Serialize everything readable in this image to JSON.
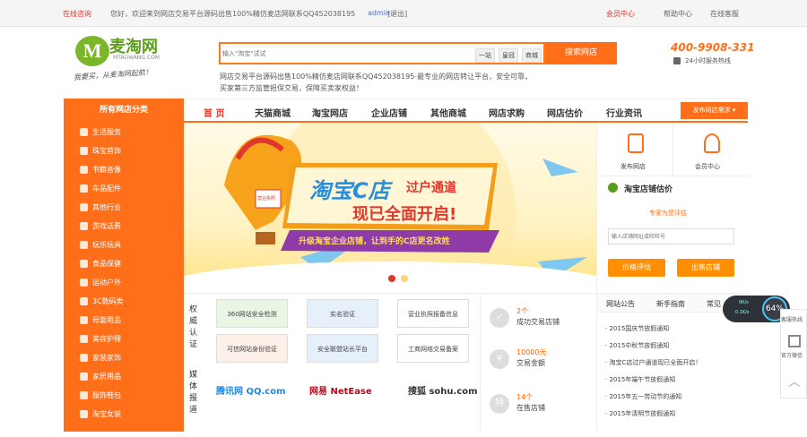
{
  "topbar": {
    "online": "在线咨询",
    "welcome": "您好，欢迎来到网店交易平台源码出售100%精仿麦店网联系QQ452038195",
    "user": "admin",
    "logout": "[退出]",
    "member": "会员中心",
    "help": "帮助中心",
    "online_service": "在线客服"
  },
  "logo": {
    "name": "麦淘网",
    "domain": "MTAOWANG.COM",
    "slogan": "我要买，从麦淘网起航！"
  },
  "search": {
    "placeholder": "输入\"淘宝\"试试",
    "filters": [
      "一站",
      "皇冠",
      "商城"
    ],
    "button": "搜索网店"
  },
  "hotline": {
    "number": "400-9908-331",
    "label": "24小时服务热线"
  },
  "description": "网店交易平台源码出售100%精仿麦店网联系QQ452038195-最专业的网店转让平台，安全可靠，买家第三方监管担保交易，保障买卖家权益！",
  "nav": {
    "category_title": "所有网店分类",
    "items": [
      "首 页",
      "天猫商城",
      "淘宝网店",
      "企业店铺",
      "其他商城",
      "网店求购",
      "网店估价",
      "行业资讯"
    ],
    "publish": "发布网店需求 ▾"
  },
  "categories": [
    "生活服务",
    "珠宝首饰",
    "书籍音像",
    "车品配件",
    "其他行业",
    "游戏话费",
    "玩乐玩具",
    "食品保健",
    "运动户外",
    "3C数码类",
    "母婴用品",
    "美容护理",
    "家装家饰",
    "家居用品",
    "服饰鞋包",
    "淘宝女装"
  ],
  "banner": {
    "title": "淘宝C店",
    "subtitle1": "过户通道",
    "subtitle2": "现已全面开启!",
    "tagline": "升级淘宝企业店铺，让到手的C店更名改姓",
    "badge": "营业执照"
  },
  "right": {
    "publish_shop": "发布网店",
    "member_center": "会员中心",
    "valuation_title": "淘宝店铺估价",
    "valuation_sub": "专家为您评估",
    "input_placeholder": "输入店铺网址或旺旺号",
    "valuation_btn": "价格评估",
    "sell_btn": "出售店铺",
    "tabs": [
      "网站公告",
      "新手指南",
      "常见"
    ],
    "news": [
      "2015国庆节放假通知",
      "2015中秋节放假通知",
      "淘宝C店过户通道现已全面开启！",
      "2015年端午节放假通知",
      "2015年五一劳动节的通知",
      "2015年清明节放假通知"
    ]
  },
  "auth": {
    "label1": "权威认证",
    "label2": "媒体报道",
    "certs": [
      "360网站安全检测",
      "实名验证",
      "营业执照报备信息",
      "可信网站身份验证",
      "安全联盟站长平台",
      "工商网络交易备案"
    ],
    "media": [
      "腾讯网 QQ.com",
      "网易 NetEase",
      "搜狐 sohu.com"
    ]
  },
  "stats": [
    {
      "icon": "✓",
      "value": "2个",
      "label": "成功交易店铺"
    },
    {
      "icon": "¥",
      "value": "10000元",
      "label": "交易金额"
    },
    {
      "icon": "特",
      "value": "14个",
      "label": "在售店铺"
    }
  ],
  "widget": {
    "percent": "64%",
    "up": "0K/s",
    "down": "0.1K/s"
  },
  "side_tools": [
    "客服热线",
    "官方微信"
  ],
  "colors": {
    "accent": "#ff6f1a",
    "red": "#e0362b",
    "side": "#ff6f1a"
  }
}
